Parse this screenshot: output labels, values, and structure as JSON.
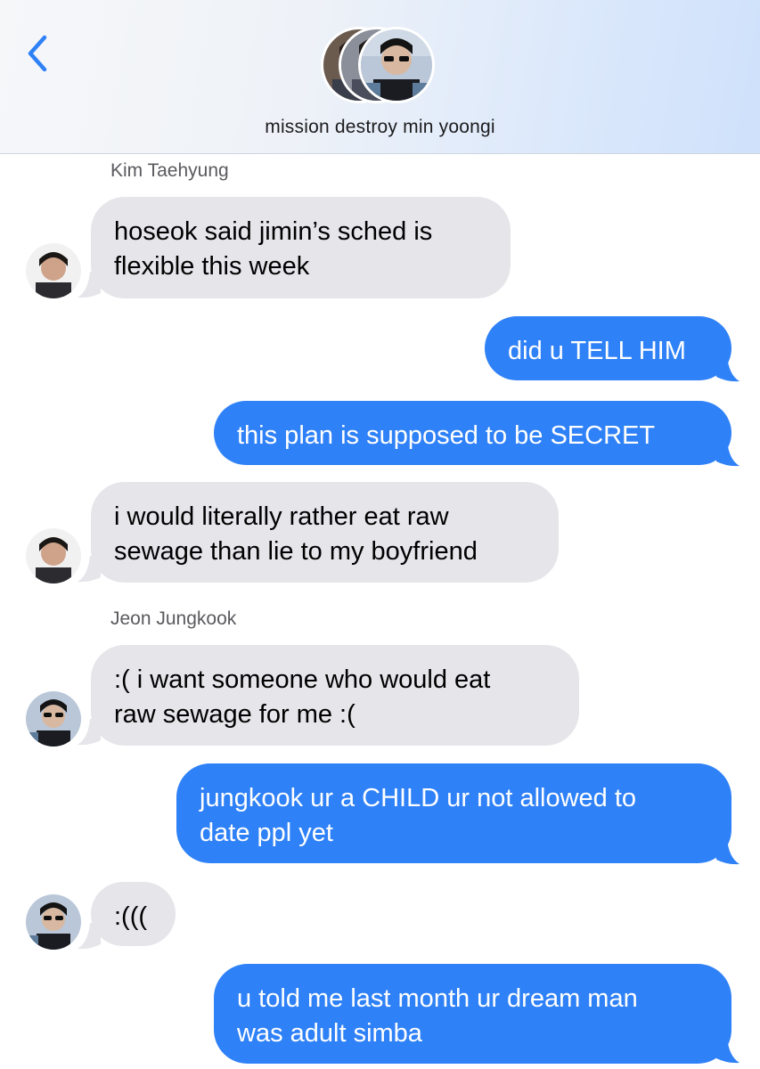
{
  "header": {
    "group_name": "mission destroy min yoongi",
    "back_icon": "chevron-left-icon",
    "back_color": "#2f81f7"
  },
  "colors": {
    "incoming_bubble": "#e5e5ea",
    "outgoing_bubble": "#2f81f7",
    "sender_label": "#5a5a5f"
  },
  "thread": {
    "senders": {
      "taehyung": "Kim Taehyung",
      "jungkook": "Jeon Jungkook"
    },
    "messages": [
      {
        "from": "Kim Taehyung",
        "direction": "incoming",
        "lines": [
          "hoseok said jimin’s sched is",
          "flexible this week"
        ]
      },
      {
        "from": "me",
        "direction": "outgoing",
        "lines": [
          "did u TELL HIM"
        ]
      },
      {
        "from": "me",
        "direction": "outgoing",
        "lines": [
          "this plan is supposed to be SECRET"
        ]
      },
      {
        "from": "Kim Taehyung",
        "direction": "incoming",
        "lines": [
          "i would literally rather eat raw",
          "sewage than lie to my boyfriend"
        ]
      },
      {
        "from": "Jeon Jungkook",
        "direction": "incoming",
        "lines": [
          ":( i want someone who would eat",
          "raw sewage for me :("
        ]
      },
      {
        "from": "me",
        "direction": "outgoing",
        "lines": [
          "jungkook ur a CHILD ur not allowed to",
          "date ppl yet"
        ]
      },
      {
        "from": "Jeon Jungkook",
        "direction": "incoming",
        "lines": [
          ":((("
        ]
      },
      {
        "from": "me",
        "direction": "outgoing",
        "lines": [
          "u told me last month ur dream man",
          "was adult simba"
        ]
      }
    ]
  }
}
